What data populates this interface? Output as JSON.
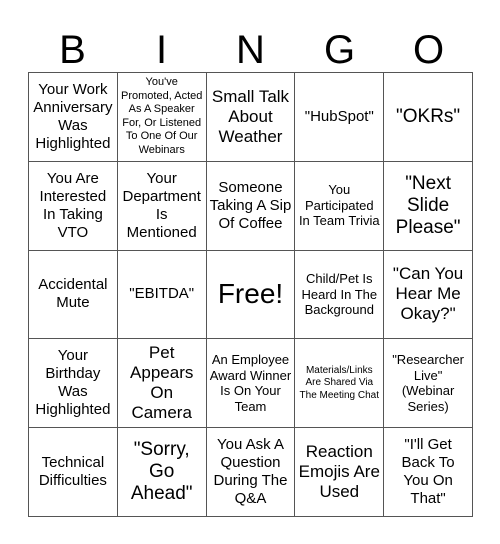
{
  "card": {
    "header_letters": [
      "B",
      "I",
      "N",
      "G",
      "O"
    ],
    "rows": [
      [
        {
          "text": "Your Work Anniversary Was Highlighted",
          "size": "md"
        },
        {
          "text": "You've Promoted, Acted As A Speaker For, Or Listened To One Of Our Webinars",
          "size": "xs"
        },
        {
          "text": "Small Talk About Weather",
          "size": "lg"
        },
        {
          "text": "\"HubSpot\"",
          "size": "md"
        },
        {
          "text": "\"OKRs\"",
          "size": "xl"
        }
      ],
      [
        {
          "text": "You Are Interested In Taking VTO",
          "size": "md"
        },
        {
          "text": "Your Department Is Mentioned",
          "size": "md"
        },
        {
          "text": "Someone Taking A Sip Of Coffee",
          "size": "md"
        },
        {
          "text": "You Participated In Team Trivia",
          "size": "sm"
        },
        {
          "text": "\"Next Slide Please\"",
          "size": "xl"
        }
      ],
      [
        {
          "text": "Accidental Mute",
          "size": "md"
        },
        {
          "text": "\"EBITDA\"",
          "size": "md"
        },
        {
          "text": "Free!",
          "size": "xxl"
        },
        {
          "text": "Child/Pet Is Heard In The Background",
          "size": "sm"
        },
        {
          "text": "\"Can You Hear Me Okay?\"",
          "size": "lg"
        }
      ],
      [
        {
          "text": "Your Birthday Was Highlighted",
          "size": "md"
        },
        {
          "text": "Pet Appears On Camera",
          "size": "lg"
        },
        {
          "text": "An Employee Award Winner Is On Your Team",
          "size": "sm"
        },
        {
          "text": "Materials/Links Are Shared Via The Meeting Chat",
          "size": "xxs"
        },
        {
          "text": "\"Researcher Live\" (Webinar Series)",
          "size": "sm"
        }
      ],
      [
        {
          "text": "Technical Difficulties",
          "size": "md"
        },
        {
          "text": "\"Sorry, Go Ahead\"",
          "size": "xl"
        },
        {
          "text": "You Ask A Question During The Q&A",
          "size": "md"
        },
        {
          "text": "Reaction Emojis Are Used",
          "size": "lg"
        },
        {
          "text": "\"I'll Get Back To You On That\"",
          "size": "md"
        }
      ]
    ],
    "colors": {
      "background": "#ffffff",
      "text": "#000000",
      "grid_line": "#555555"
    }
  }
}
